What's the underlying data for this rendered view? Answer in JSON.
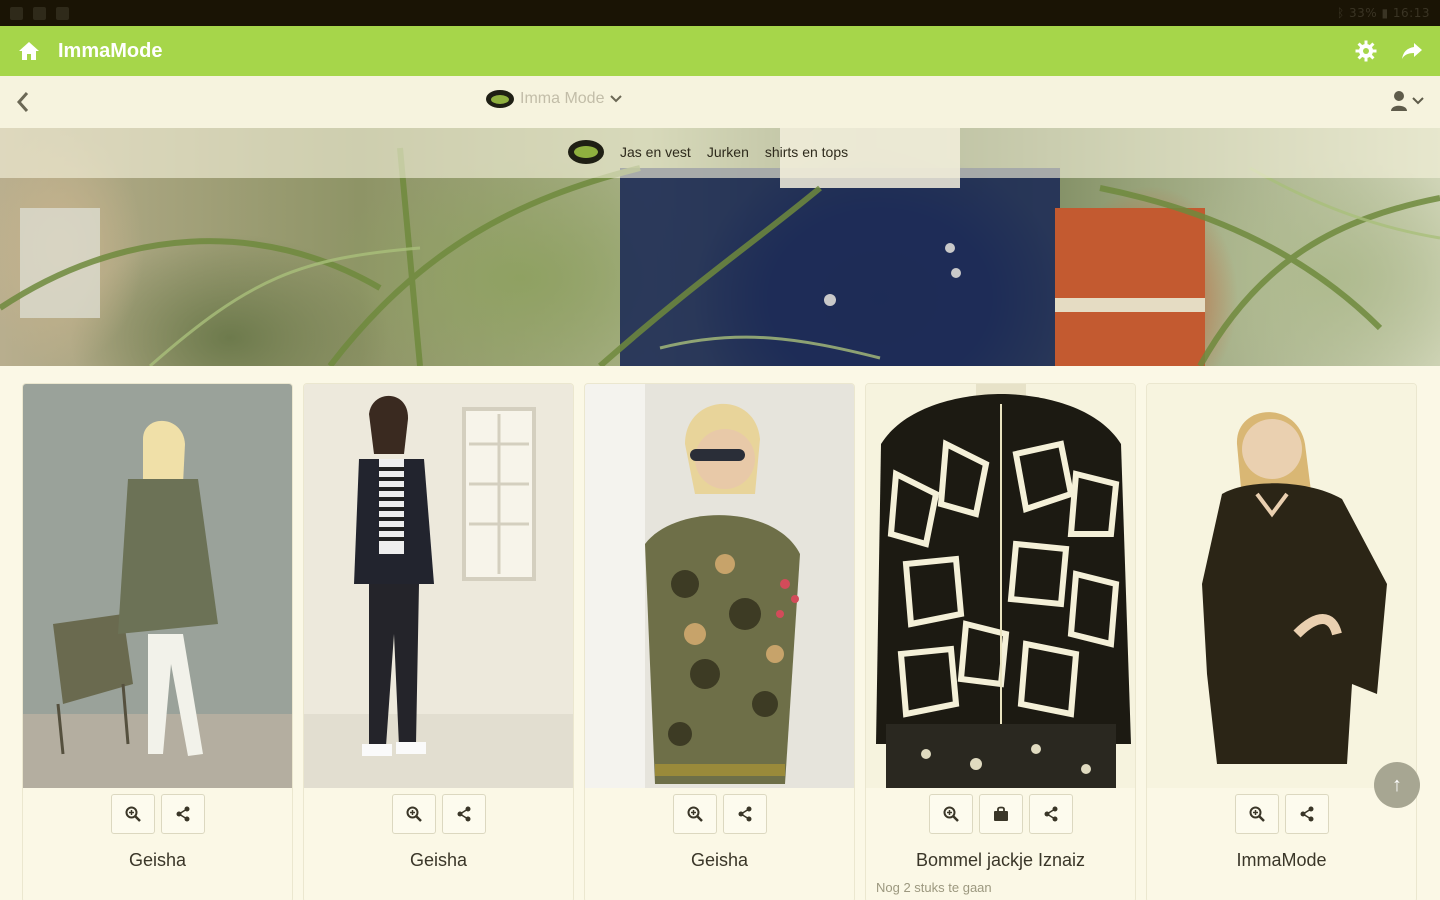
{
  "status_bar": {
    "right_text": "ᛒ 33% ▮ 16:13"
  },
  "app_bar": {
    "title": "ImmaMode",
    "accent": "#a6d64a"
  },
  "nav": {
    "store_name": "Imma Mode"
  },
  "categories": [
    "Jas en vest",
    "Jurken",
    "shirts en tops"
  ],
  "products": [
    {
      "name": "Geisha",
      "actions": [
        "zoom-icon",
        "share-icon"
      ]
    },
    {
      "name": "Geisha",
      "actions": [
        "zoom-icon",
        "share-icon"
      ]
    },
    {
      "name": "Geisha",
      "actions": [
        "zoom-icon",
        "share-icon"
      ]
    },
    {
      "name": "Bommel jackje Iznaiz",
      "stock_note": "Nog 2 stuks te gaan",
      "actions": [
        "zoom-icon",
        "bag-icon",
        "share-icon"
      ]
    },
    {
      "name": "ImmaMode",
      "actions": [
        "zoom-icon",
        "share-icon"
      ]
    }
  ],
  "fab": {
    "label": "↑"
  }
}
